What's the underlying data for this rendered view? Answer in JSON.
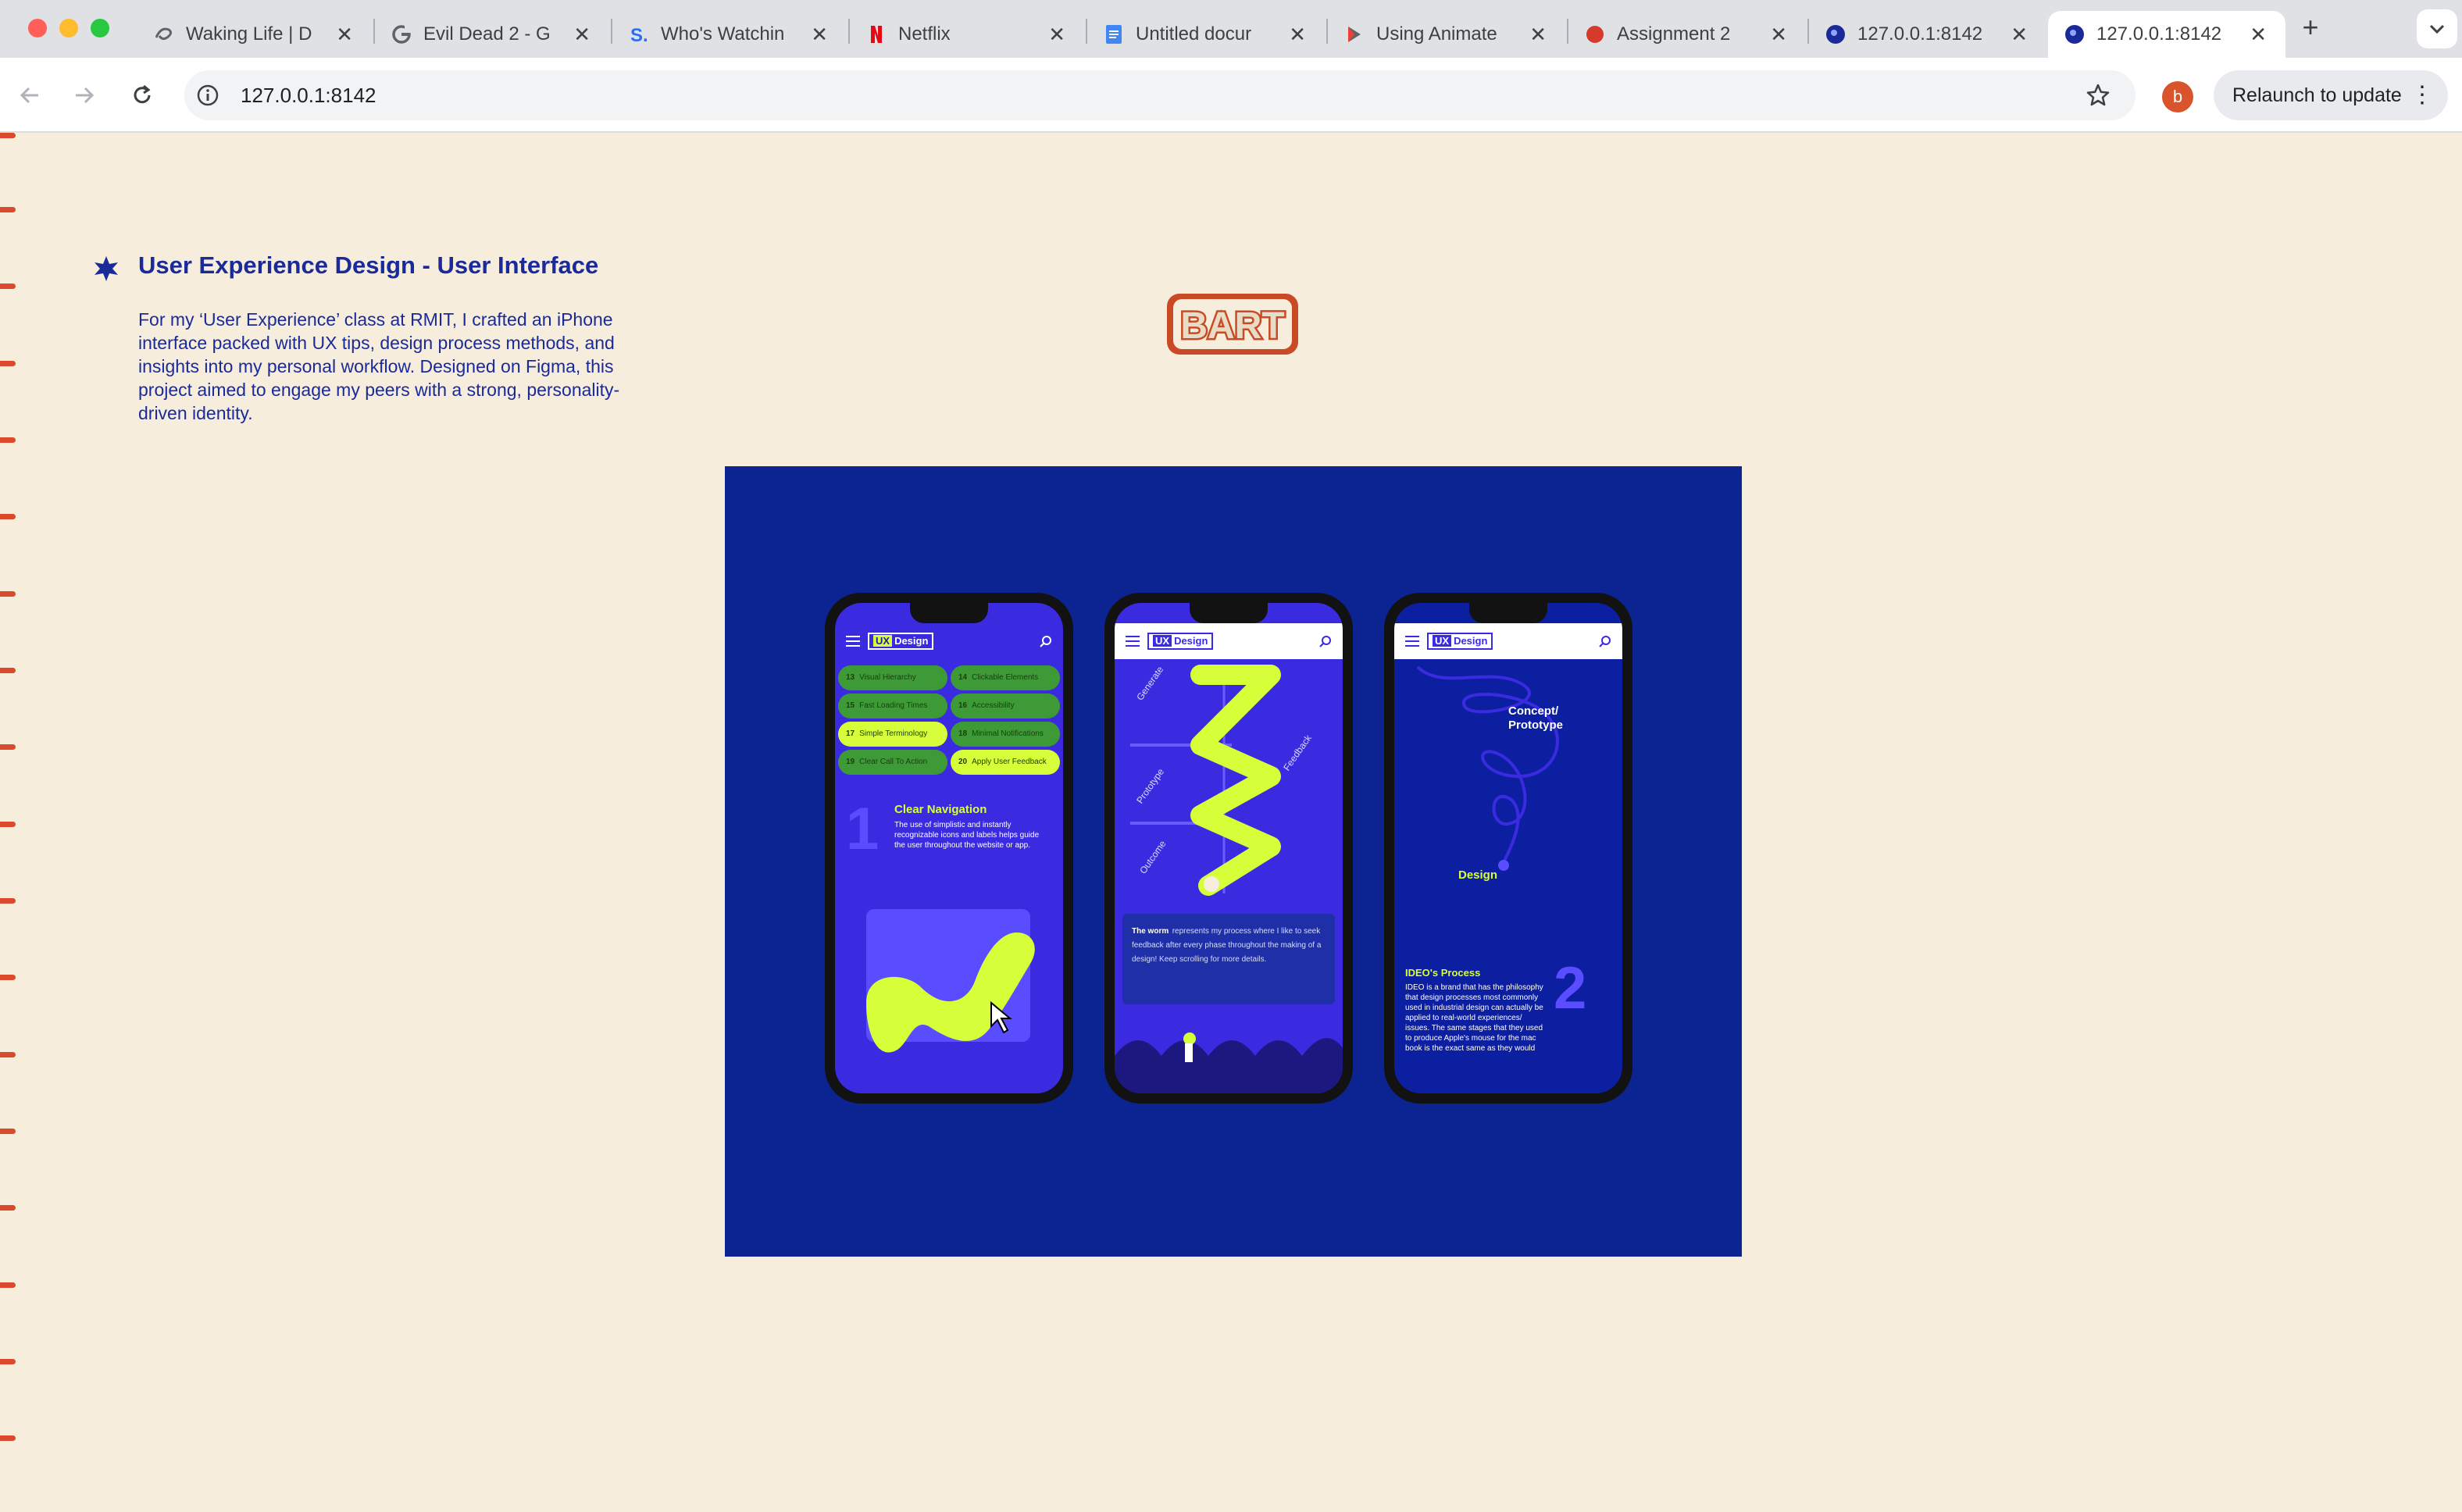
{
  "browser": {
    "tabs": [
      {
        "title": "Waking Life | D",
        "icon": "letterboxd-icon",
        "active": false
      },
      {
        "title": "Evil Dead 2 - G",
        "icon": "google-icon",
        "active": false
      },
      {
        "title": "Who's Watchin",
        "icon": "streaming-s-icon",
        "active": false
      },
      {
        "title": "Netflix",
        "icon": "netflix-icon",
        "active": false
      },
      {
        "title": "Untitled docur",
        "icon": "google-docs-icon",
        "active": false
      },
      {
        "title": "Using Animate",
        "icon": "animate-icon",
        "active": false
      },
      {
        "title": "Assignment 2",
        "icon": "red-blob-icon",
        "active": false
      },
      {
        "title": "127.0.0.1:8142",
        "icon": "site-dot-icon",
        "active": false
      },
      {
        "title": "127.0.0.1:8142",
        "icon": "site-dot-icon",
        "active": true
      }
    ],
    "url": "127.0.0.1:8142",
    "profile_initial": "b",
    "relaunch_label": "Relaunch to update",
    "colors": {
      "tabbar": "#dfe1e5",
      "accent_red": "#d9542a"
    }
  },
  "page": {
    "background": "#f6eddd",
    "project": {
      "title": "User Experience Design - User Interface",
      "description": "For my ‘User Experience’ class at RMIT, I crafted an iPhone interface packed with UX tips, design process methods, and insights into my personal workflow. Designed on Figma, this project aimed to engage my peers with a strong, personality-driven identity."
    },
    "logo_text": "BART",
    "hero": {
      "background": "#0c2491",
      "phone1": {
        "badge_ux": "UX",
        "badge_text": "Design",
        "pills": [
          {
            "num": "13",
            "text": "Visual Hierarchy"
          },
          {
            "num": "14",
            "text": "Clickable Elements"
          },
          {
            "num": "15",
            "text": "Fast Loading Times"
          },
          {
            "num": "16",
            "text": "Accessibility"
          },
          {
            "num": "17",
            "text": "Simple Terminology"
          },
          {
            "num": "18",
            "text": "Minimal Notifications"
          },
          {
            "num": "19",
            "text": "Clear Call To Action"
          },
          {
            "num": "20",
            "text": "Apply User Feedback"
          }
        ],
        "number": "1",
        "section_title": "Clear Navigation",
        "section_text": "The use of simplistic and instantly recognizable icons and labels helps guide the user throughout the website or app."
      },
      "phone2": {
        "badge_ux": "UX",
        "badge_text": "Design",
        "labels": [
          "Generate",
          "Feedback",
          "Prototype",
          "Outcome"
        ],
        "card_bold": "The worm",
        "card_text": "represents my process where I like to seek feedback after every phase throughout the making of a design! Keep scrolling for more details."
      },
      "phone3": {
        "badge_ux": "UX",
        "badge_text": "Design",
        "concept_label": "Concept/ Prototype",
        "design_label": "Design",
        "number": "2",
        "section_title": "IDEO's Process",
        "section_text": "IDEO is a brand that has the philosophy that design processes most commonly used in industrial design can actually be applied to real-world experiences/ issues. The same stages that they used to produce Apple's mouse for the mac book is the exact same as they would"
      },
      "colors": {
        "lime": "#d6ff3a",
        "violet": "#3b2be0",
        "green": "#3d9a37"
      }
    }
  }
}
